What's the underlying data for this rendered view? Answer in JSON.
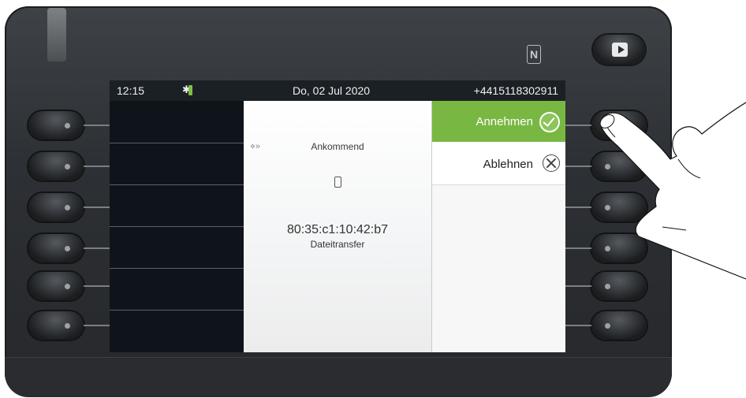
{
  "status": {
    "time": "12:15",
    "date": "Do, 02 Jul 2020",
    "number": "+4415118302911"
  },
  "call": {
    "state_label": "Ankommend",
    "address": "80:35:c1:10:42:b7",
    "subtitle": "Dateitransfer"
  },
  "actions": {
    "accept_label": "Annehmen",
    "reject_label": "Ablehnen"
  },
  "icons": {
    "status_bt": "bluetooth-icon",
    "accept_icon": "check-circle-icon",
    "reject_icon": "x-circle-icon",
    "nfc": "nfc-icon",
    "exit": "exit-icon",
    "device": "phone-icon",
    "state_icon": "bluetooth-icon"
  },
  "colors": {
    "accent": "#79b743",
    "screen_bg": "#0f141a",
    "battery": "#7dc243"
  }
}
